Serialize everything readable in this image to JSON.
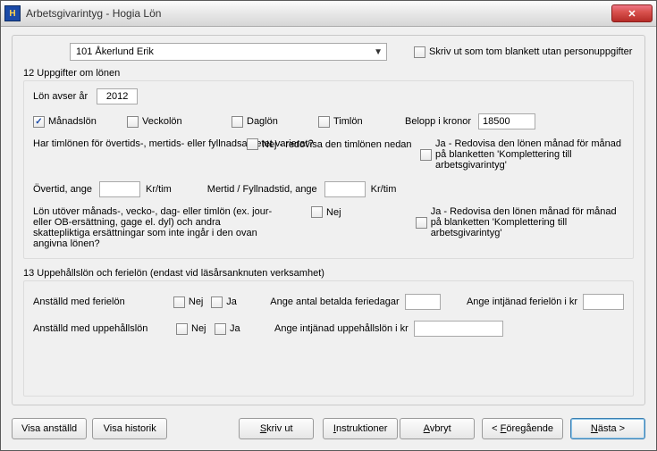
{
  "window": {
    "title": "Arbetsgivarintyg - Hogia Lön"
  },
  "top": {
    "employee": "101 Åkerlund Erik",
    "blank_form": "Skriv ut som tom blankett utan personuppgifter"
  },
  "section12": {
    "header": "12  Uppgifter om lönen",
    "lon_avser_ar_lbl": "Lön avser år",
    "lon_avser_ar_val": "2012",
    "manadslon": "Månadslön",
    "veckolon": "Veckolön",
    "daglon": "Daglön",
    "timlon": "Timlön",
    "belopp_lbl": "Belopp i kronor",
    "belopp_val": "18500",
    "q1": "Har timlönen för övertids-, mertids- eller fyllnadsarbetet varierat?",
    "q1_nej": "Nej - redovisa den timlönen nedan",
    "q1_ja": "Ja - Redovisa den lönen månad för månad på blanketten 'Komplettering till arbetsgivarintyg'",
    "overtid_lbl": "Övertid, ange",
    "kr_tim": "Kr/tim",
    "mertid_lbl": "Mertid / Fyllnadstid, ange",
    "q2": "Lön utöver månads-, vecko-, dag- eller timlön (ex. jour- eller OB-ersättning, gage el. dyl) och andra skattepliktiga ersättningar som inte ingår i den ovan angivna lönen?",
    "q2_nej": "Nej",
    "q2_ja": "Ja - Redovisa den lönen månad för månad på blanketten 'Komplettering till arbetsgivarintyg'"
  },
  "section13": {
    "header": "13 Uppehållslön och ferielön (endast vid läsårsanknuten verksamhet)",
    "anst_ferie": "Anställd med ferielön",
    "anst_uppeh": "Anställd med uppehållslön",
    "nej": "Nej",
    "ja": "Ja",
    "betalda_feriedagar": "Ange antal betalda feriedagar",
    "intjanad_ferie": "Ange intjänad ferielön i kr",
    "intjanad_uppeh": "Ange intjänad uppehållslön i kr"
  },
  "buttons": {
    "visa_anstalld": "Visa anställd",
    "visa_historik": "Visa historik",
    "skriv_ut": "Skriv ut",
    "instruktioner": "Instruktioner",
    "avbryt": "Avbryt",
    "foregaende": "< Föregående",
    "nasta": "Nästa >"
  }
}
